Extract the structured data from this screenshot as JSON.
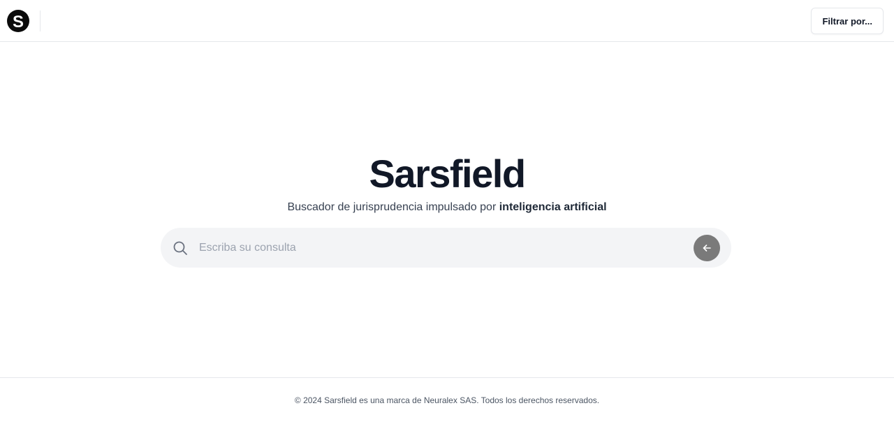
{
  "header": {
    "logo_icon": "sarsfield-s-logo-icon",
    "filter_label": "Filtrar por..."
  },
  "hero": {
    "title": "Sarsfield",
    "subtitle_prefix": "Buscador de jurisprudencia impulsado por ",
    "subtitle_emphasis": "inteligencia artificial"
  },
  "search": {
    "placeholder": "Escriba su consulta",
    "value": "",
    "search_icon": "search-icon",
    "submit_icon": "arrow-left-icon"
  },
  "footer": {
    "copyright": "© 2024 Sarsfield es una marca de Neuralex SAS. Todos los derechos reservados."
  },
  "colors": {
    "text_primary": "#111827",
    "search_bg": "#f3f4f6",
    "submit_bg": "#7a7a7a",
    "border": "#e5e7eb"
  }
}
